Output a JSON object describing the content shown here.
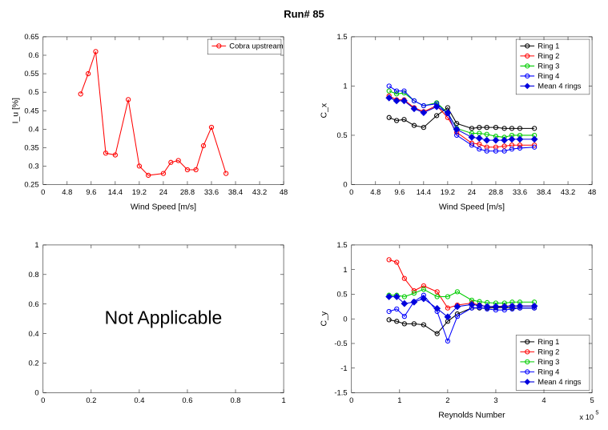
{
  "page_title": "Run# 85",
  "chart_data": [
    {
      "id": "topleft",
      "type": "line",
      "xlabel": "Wind Speed [m/s]",
      "ylabel": "I_u [%]",
      "xlim": [
        0,
        48
      ],
      "ylim": [
        0.25,
        0.65
      ],
      "xticks": [
        0,
        4.8,
        9.6,
        14.4,
        19.2,
        24,
        28.8,
        33.6,
        38.4,
        43.2,
        48
      ],
      "yticks": [
        0.25,
        0.3,
        0.35,
        0.4,
        0.45,
        0.5,
        0.55,
        0.6,
        0.65
      ],
      "series": [
        {
          "name": "Cobra upstream",
          "color": "#ff0000",
          "marker": "o",
          "x": [
            7.5,
            9.0,
            10.5,
            12.5,
            14.4,
            17.0,
            19.2,
            21.0,
            24.0,
            25.5,
            27.0,
            28.8,
            30.5,
            32.0,
            33.6,
            36.5
          ],
          "y": [
            0.495,
            0.55,
            0.61,
            0.335,
            0.33,
            0.48,
            0.3,
            0.275,
            0.28,
            0.31,
            0.315,
            0.29,
            0.29,
            0.355,
            0.405,
            0.28
          ]
        }
      ],
      "legend_pos": "top-right"
    },
    {
      "id": "topright",
      "type": "line",
      "xlabel": "Wind Speed [m/s]",
      "ylabel": "C_x",
      "xlim": [
        0,
        48
      ],
      "ylim": [
        0,
        1.5
      ],
      "xticks": [
        0,
        4.8,
        9.6,
        14.4,
        19.2,
        24,
        28.8,
        33.6,
        38.4,
        43.2,
        48
      ],
      "yticks": [
        0,
        0.5,
        1,
        1.5
      ],
      "x": [
        7.5,
        9.0,
        10.5,
        12.5,
        14.4,
        17.0,
        19.2,
        21.0,
        24.0,
        25.5,
        27.0,
        28.8,
        30.5,
        32.0,
        33.6,
        36.5
      ],
      "series": [
        {
          "name": "Ring 1",
          "color": "#000000",
          "marker": "o",
          "y": [
            0.68,
            0.65,
            0.66,
            0.6,
            0.58,
            0.7,
            0.78,
            0.62,
            0.57,
            0.58,
            0.58,
            0.58,
            0.57,
            0.57,
            0.57,
            0.57
          ]
        },
        {
          "name": "Ring 2",
          "color": "#ff0000",
          "marker": "o",
          "y": [
            0.9,
            0.86,
            0.86,
            0.78,
            0.74,
            0.8,
            0.68,
            0.53,
            0.42,
            0.41,
            0.38,
            0.38,
            0.39,
            0.4,
            0.4,
            0.4
          ]
        },
        {
          "name": "Ring 3",
          "color": "#00cc00",
          "marker": "o",
          "y": [
            0.95,
            0.92,
            0.93,
            0.85,
            0.8,
            0.83,
            0.73,
            0.57,
            0.52,
            0.52,
            0.51,
            0.49,
            0.48,
            0.5,
            0.5,
            0.5
          ]
        },
        {
          "name": "Ring 4",
          "color": "#0000ff",
          "marker": "o",
          "y": [
            1.0,
            0.95,
            0.95,
            0.85,
            0.8,
            0.82,
            0.72,
            0.5,
            0.4,
            0.36,
            0.34,
            0.34,
            0.34,
            0.36,
            0.37,
            0.38
          ]
        },
        {
          "name": "Mean 4 rings",
          "color": "#0000dd",
          "marker": "d",
          "filled": true,
          "y": [
            0.88,
            0.85,
            0.85,
            0.77,
            0.73,
            0.79,
            0.73,
            0.56,
            0.48,
            0.47,
            0.45,
            0.45,
            0.45,
            0.46,
            0.46,
            0.46
          ]
        }
      ],
      "legend_pos": "top-right"
    },
    {
      "id": "bottomleft",
      "type": "empty",
      "xlabel": "",
      "ylabel": "",
      "xlim": [
        0,
        1
      ],
      "ylim": [
        0,
        1
      ],
      "xticks": [
        0,
        0.2,
        0.4,
        0.6,
        0.8,
        1
      ],
      "yticks": [
        0,
        0.2,
        0.4,
        0.6,
        0.8,
        1
      ],
      "text": "Not Applicable"
    },
    {
      "id": "bottomright",
      "type": "line",
      "xlabel": "Reynolds Number",
      "ylabel": "C_y",
      "xlim": [
        0,
        5
      ],
      "ylim": [
        -1.5,
        1.5
      ],
      "xticks": [
        0,
        1,
        2,
        3,
        4,
        5
      ],
      "yticks": [
        -1.5,
        -1,
        -0.5,
        0,
        0.5,
        1,
        1.5
      ],
      "x_note": "x 10^5",
      "x": [
        0.78,
        0.94,
        1.1,
        1.3,
        1.5,
        1.78,
        2.0,
        2.2,
        2.5,
        2.66,
        2.82,
        3.0,
        3.18,
        3.34,
        3.5,
        3.8
      ],
      "series": [
        {
          "name": "Ring 1",
          "color": "#000000",
          "marker": "o",
          "y": [
            -0.02,
            -0.05,
            -0.1,
            -0.1,
            -0.12,
            -0.3,
            -0.05,
            0.1,
            0.22,
            0.22,
            0.22,
            0.23,
            0.23,
            0.22,
            0.22,
            0.22
          ]
        },
        {
          "name": "Ring 2",
          "color": "#ff0000",
          "marker": "o",
          "y": [
            1.2,
            1.15,
            0.82,
            0.57,
            0.67,
            0.55,
            0.22,
            0.28,
            0.32,
            0.28,
            0.25,
            0.25,
            0.26,
            0.26,
            0.26,
            0.26
          ]
        },
        {
          "name": "Ring 3",
          "color": "#00cc00",
          "marker": "o",
          "y": [
            0.48,
            0.48,
            0.45,
            0.52,
            0.6,
            0.45,
            0.45,
            0.55,
            0.38,
            0.35,
            0.33,
            0.32,
            0.32,
            0.34,
            0.34,
            0.34
          ]
        },
        {
          "name": "Ring 4",
          "color": "#0000ff",
          "marker": "o",
          "y": [
            0.15,
            0.2,
            0.05,
            0.35,
            0.48,
            0.15,
            -0.45,
            0.05,
            0.22,
            0.23,
            0.2,
            0.18,
            0.18,
            0.2,
            0.22,
            0.22
          ]
        },
        {
          "name": "Mean 4 rings",
          "color": "#0000dd",
          "marker": "d",
          "filled": true,
          "y": [
            0.45,
            0.45,
            0.31,
            0.34,
            0.41,
            0.21,
            0.04,
            0.25,
            0.29,
            0.27,
            0.25,
            0.25,
            0.25,
            0.26,
            0.26,
            0.26
          ]
        }
      ],
      "legend_pos": "bottom-right"
    }
  ]
}
